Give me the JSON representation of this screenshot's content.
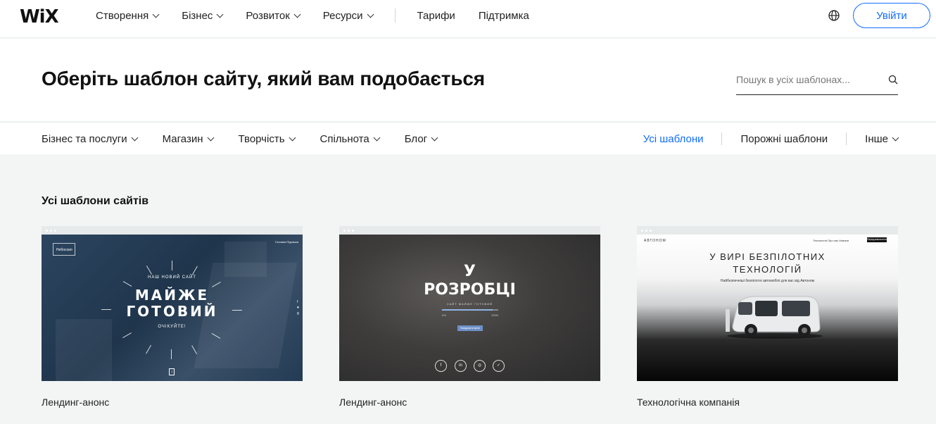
{
  "topbar": {
    "logo": "WiX",
    "nav": [
      {
        "label": "Створення",
        "dropdown": true
      },
      {
        "label": "Бізнес",
        "dropdown": true
      },
      {
        "label": "Розвиток",
        "dropdown": true
      },
      {
        "label": "Ресурси",
        "dropdown": true
      }
    ],
    "nav_plain": [
      "Тарифи",
      "Підтримка"
    ],
    "login_label": "Увійти",
    "globe_icon": "globe-icon",
    "accent": "#116dff"
  },
  "hero": {
    "title": "Оберіть шаблон сайту, який вам подобається",
    "search_placeholder": "Пошук в усіх шаблонах..."
  },
  "categories": {
    "left": [
      "Бізнес та послуги",
      "Магазин",
      "Творчість",
      "Спільнота",
      "Блог"
    ],
    "all": "Усі шаблони",
    "blank": "Порожні шаблони",
    "other": "Інше"
  },
  "section_title": "Усі шаблони сайтів",
  "templates": [
    {
      "label": "Лендинг-анонс",
      "preview": {
        "brand": "Небосхил",
        "nav": "Головна   Підписка",
        "kicker": "НАШ НОВИЙ САЙТ",
        "line1": "МАЙЖЕ",
        "line2": "ГОТОВИЙ",
        "footer": "ОЧІКУЙТЕ!",
        "social": "f\n♥\ng"
      }
    },
    {
      "label": "Лендинг-анонс",
      "preview": {
        "line1": "У",
        "line2": "РОЗРОБЦІ",
        "kicker": "САЙТ МАЙЖЕ ГОТОВИЙ",
        "progress": 0.9,
        "progress_start": "0%",
        "progress_end": "100%",
        "button": "Повідомити мене",
        "social": [
          "f",
          "in",
          "◎",
          "✓"
        ]
      }
    },
    {
      "label": "Технологічна компанія",
      "preview": {
        "brand": "АВТОНОМ",
        "nav": "Технологія   Про нас   Новини",
        "button": "Передзамовлення",
        "line1": "У ВИРІ БЕЗПІЛОТНИХ",
        "line2": "ТЕХНОЛОГІЙ",
        "sub": "Найбезпечніші безпілотні автомобілі для вас від Автоном"
      }
    }
  ]
}
